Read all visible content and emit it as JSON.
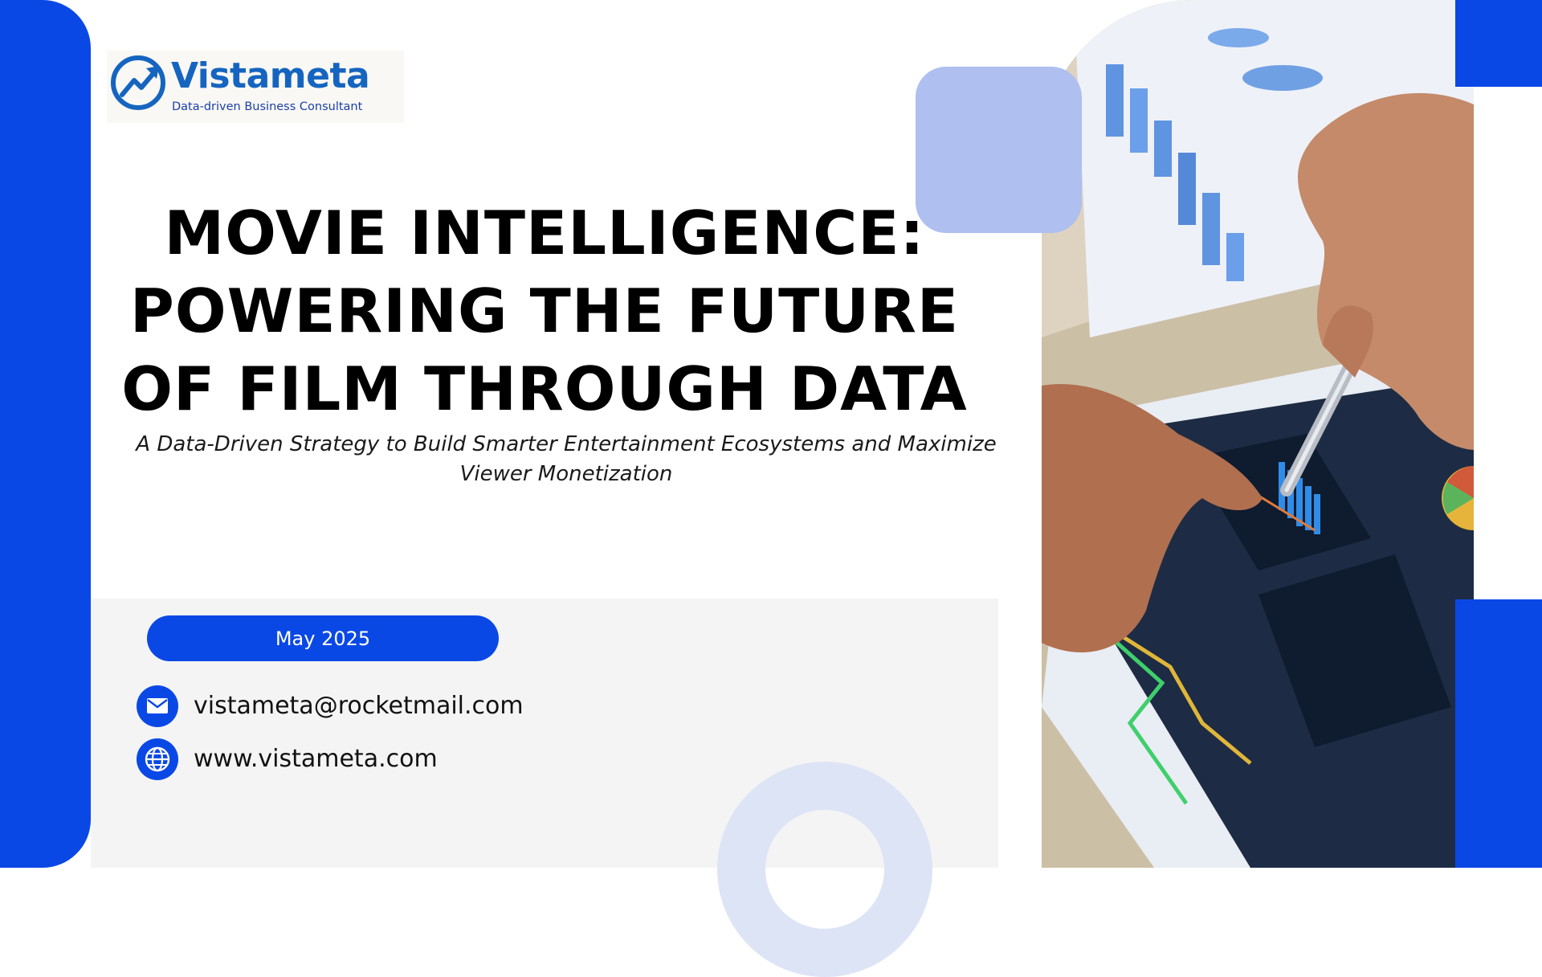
{
  "logo": {
    "name": "Vistameta",
    "tagline": "Data-driven Business Consultant",
    "icon": "trend-chart-icon",
    "color": "#1565c0"
  },
  "title": {
    "lines": [
      "MOVIE INTELLIGENCE:",
      "POWERING THE FUTURE",
      "OF FILM THROUGH DATA"
    ]
  },
  "subtitle": {
    "lines": [
      "A Data-Driven Strategy to Build Smarter Entertainment Ecosystems and Maximize",
      "Viewer Monetization"
    ]
  },
  "date": "May 2025",
  "contacts": [
    {
      "icon": "mail-icon",
      "text": "vistameta@rocketmail.com"
    },
    {
      "icon": "globe-icon",
      "text": "www.vistameta.com"
    }
  ],
  "colors": {
    "accent": "#0a48e6",
    "soft_blue": "#aebff0",
    "panel": "#f4f4f4"
  }
}
